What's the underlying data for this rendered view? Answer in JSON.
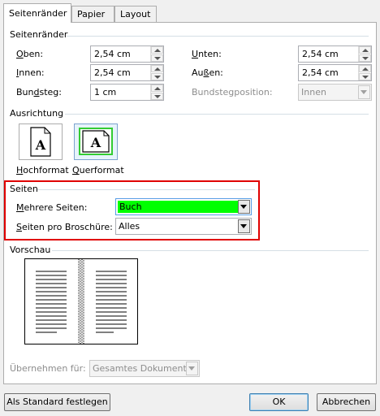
{
  "tabs": [
    "Seitenränder",
    "Papier",
    "Layout"
  ],
  "margins": {
    "section_title": "Seitenränder",
    "oben": {
      "label": "Oben:",
      "value": "2,54 cm"
    },
    "unten": {
      "label": "Unten:",
      "value": "2,54 cm"
    },
    "innen": {
      "label": "Innen:",
      "value": "2,54 cm"
    },
    "aussen": {
      "label": "Außen:",
      "value": "2,54 cm"
    },
    "bundsteg": {
      "label": "Bundsteg:",
      "value": "1 cm"
    },
    "bundstegposition": {
      "label": "Bundstegposition:",
      "value": "Innen"
    }
  },
  "orientation": {
    "section_title": "Ausrichtung",
    "portrait_label": "Hochformat",
    "landscape_label": "Querformat",
    "glyph": "A"
  },
  "pages": {
    "section_title": "Seiten",
    "multiple_label": "Mehrere Seiten:",
    "multiple_value": "Buch",
    "per_booklet_label": "Seiten pro Broschüre:",
    "per_booklet_value": "Alles"
  },
  "preview": {
    "section_title": "Vorschau"
  },
  "apply_to": {
    "label": "Übernehmen für:",
    "value": "Gesamtes Dokument"
  },
  "buttons": {
    "set_default": "Als Standard festlegen",
    "ok": "OK",
    "cancel": "Abbrechen"
  },
  "colors": {
    "highlight_box": "#e00000",
    "selected_value_bg": "#00ff00",
    "landscape_outline": "#33cc33"
  },
  "icons": [
    "spin-up-icon",
    "spin-down-icon",
    "dropdown-arrow-icon",
    "portrait-page-icon",
    "landscape-page-icon",
    "book-preview-icon"
  ]
}
